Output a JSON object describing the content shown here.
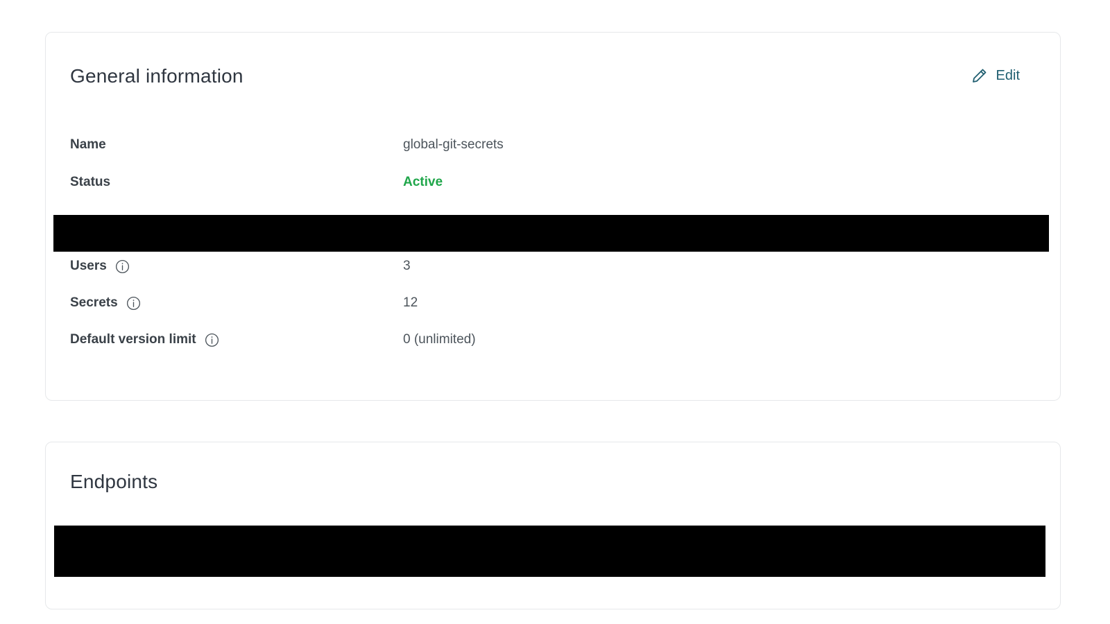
{
  "general": {
    "title": "General information",
    "edit_label": "Edit",
    "rows": [
      {
        "label": "Name",
        "value": "global-git-secrets"
      },
      {
        "label": "Status",
        "value": "Active"
      },
      {
        "label": "Users",
        "value": "3"
      },
      {
        "label": "Secrets",
        "value": "12"
      },
      {
        "label": "Default version limit",
        "value": "0 (unlimited)"
      }
    ]
  },
  "endpoints": {
    "title": "Endpoints"
  },
  "icons": {
    "edit": "pencil-icon",
    "info": "info-icon"
  },
  "colors": {
    "status_active": "#1fa64a",
    "edit_link": "#1f5e70",
    "redaction": "#000000"
  }
}
